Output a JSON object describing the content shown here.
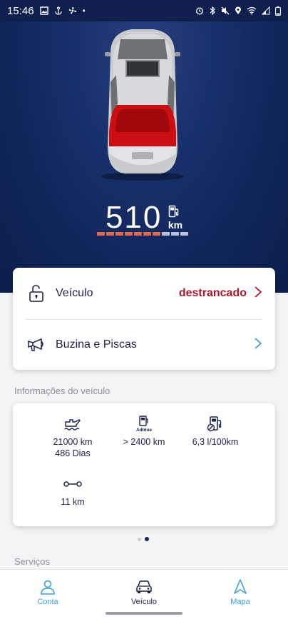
{
  "status_bar": {
    "time": "15:46",
    "battery_pct": 20
  },
  "vehicle": {
    "range_value": "510",
    "range_unit": "km",
    "fuel_gauge_segments": {
      "filled": 7,
      "total": 10
    },
    "colors": {
      "hero_bg": "#0f2458",
      "gauge_fill": "#e0684c",
      "gauge_empty": "#b9c2dc"
    }
  },
  "actions": {
    "lock": {
      "label": "Veículo",
      "status": "destrancado",
      "icon": "lock-open-icon"
    },
    "horn": {
      "label": "Buzina e Piscas",
      "icon": "horn-icon"
    }
  },
  "info": {
    "title": "Informações do veículo",
    "items": [
      {
        "icon": "oil-can-icon",
        "line1": "21000 km",
        "line2": "486 Dias"
      },
      {
        "icon": "adblue-icon",
        "icon_text": "Adblue",
        "line1": "> 2400 km"
      },
      {
        "icon": "fuel-consumption-icon",
        "line1": "6,3 l/100km"
      },
      {
        "icon": "trip-odometer-icon",
        "line1": "11 km"
      }
    ]
  },
  "pager": {
    "pages": 2,
    "active": 2
  },
  "services": {
    "title": "Serviços"
  },
  "bottom_nav": {
    "items": [
      {
        "label": "Conta",
        "icon": "person-icon"
      },
      {
        "label": "Veículo",
        "icon": "car-front-icon"
      },
      {
        "label": "Mapa",
        "icon": "navigation-arrow-icon"
      }
    ]
  }
}
